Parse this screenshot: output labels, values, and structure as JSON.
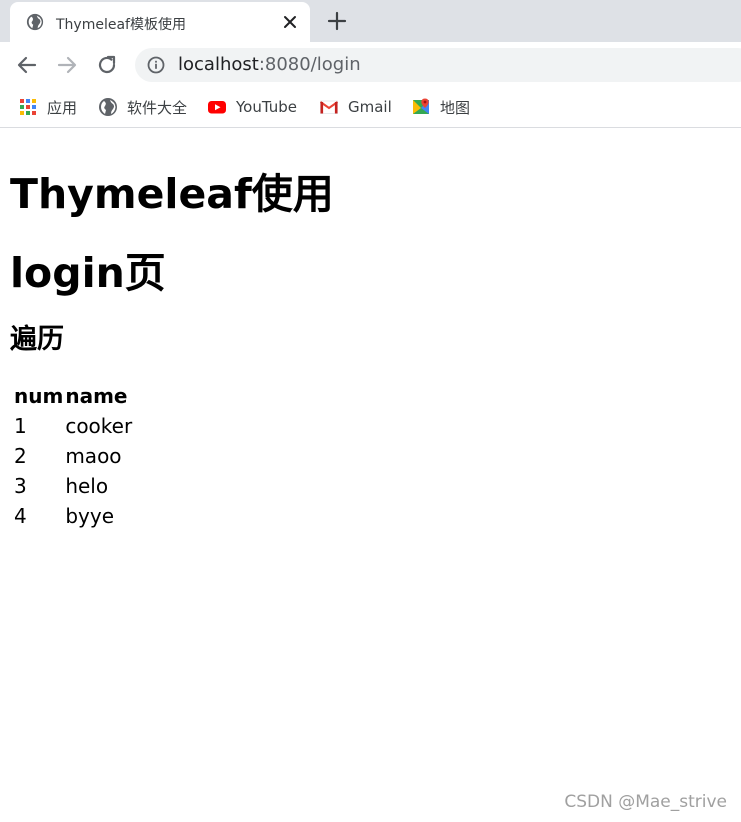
{
  "browser": {
    "tab": {
      "title": "Thymeleaf模板使用",
      "favicon": "globe-icon"
    },
    "address_bar": {
      "host": "localhost",
      "rest": ":8080/login"
    },
    "bookmarks": [
      {
        "label": "应用",
        "icon": "apps-grid-icon"
      },
      {
        "label": "软件大全",
        "icon": "globe-icon"
      },
      {
        "label": "YouTube",
        "icon": "youtube-icon"
      },
      {
        "label": "Gmail",
        "icon": "gmail-icon"
      },
      {
        "label": "地图",
        "icon": "maps-icon"
      }
    ]
  },
  "page": {
    "heading1": "Thymeleaf使用",
    "heading2": "login页",
    "heading3": "遍历",
    "table": {
      "headers": [
        "num",
        "name"
      ],
      "rows": [
        [
          "1",
          "cooker"
        ],
        [
          "2",
          "maoo"
        ],
        [
          "3",
          "helo"
        ],
        [
          "4",
          "byye"
        ]
      ]
    }
  },
  "watermark": "CSDN @Mae_strive",
  "colors": {
    "tabstrip": "#dee1e6",
    "omnibox": "#f1f3f4",
    "youtube_red": "#ff0000"
  }
}
